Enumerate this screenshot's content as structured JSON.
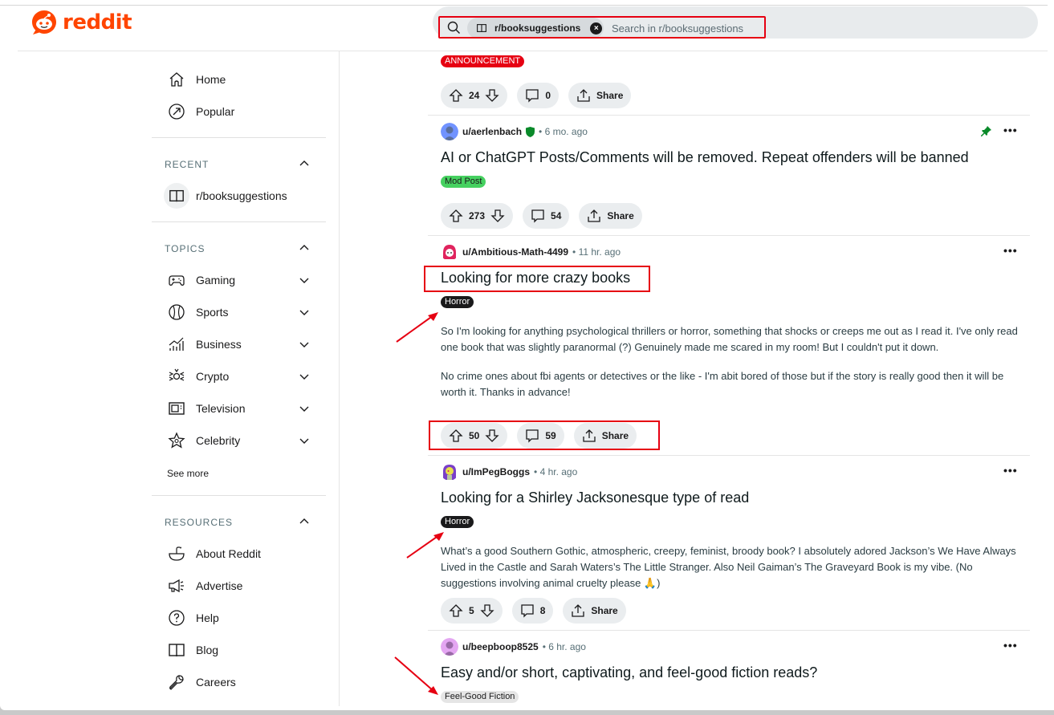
{
  "app": {
    "logo_text": "reddit",
    "brand_color": "#ff4500"
  },
  "search": {
    "community_chip": "r/booksuggestions",
    "placeholder": "Search in r/booksuggestions"
  },
  "sidebar": {
    "primary": [
      {
        "label": "Home",
        "icon": "home-icon"
      },
      {
        "label": "Popular",
        "icon": "popular-icon"
      }
    ],
    "recent": {
      "title": "RECENT",
      "items": [
        {
          "label": "r/booksuggestions",
          "icon": "book-icon"
        }
      ]
    },
    "topics": {
      "title": "TOPICS",
      "items": [
        {
          "label": "Gaming",
          "icon": "gamepad-icon"
        },
        {
          "label": "Sports",
          "icon": "ball-icon"
        },
        {
          "label": "Business",
          "icon": "chart-icon"
        },
        {
          "label": "Crypto",
          "icon": "crypto-icon"
        },
        {
          "label": "Television",
          "icon": "tv-icon"
        },
        {
          "label": "Celebrity",
          "icon": "star-icon"
        }
      ],
      "see_more": "See more"
    },
    "resources": {
      "title": "RESOURCES",
      "items": [
        {
          "label": "About Reddit",
          "icon": "reddit-icon"
        },
        {
          "label": "Advertise",
          "icon": "megaphone-icon"
        },
        {
          "label": "Help",
          "icon": "help-icon"
        },
        {
          "label": "Blog",
          "icon": "book-icon"
        },
        {
          "label": "Careers",
          "icon": "wrench-icon"
        }
      ]
    }
  },
  "posts": [
    {
      "flair": "ANNOUNCEMENT",
      "flair_bg": "#e60012",
      "flair_color": "#ffffff",
      "votes": "24",
      "comments": "0",
      "share": "Share"
    },
    {
      "author": "u/aerlenbach",
      "time": "6 mo. ago",
      "pinned": true,
      "moderator": true,
      "title": "AI or ChatGPT Posts/Comments will be removed. Repeat offenders will be banned",
      "flair": "Mod Post",
      "flair_bg": "#46d160",
      "flair_color": "#1a1a1b",
      "votes": "273",
      "comments": "54",
      "share": "Share"
    },
    {
      "author": "u/Ambitious-Math-4499",
      "time": "11 hr. ago",
      "title": "Looking for more crazy books",
      "flair": "Horror",
      "flair_bg": "#1a1a1b",
      "flair_color": "#ffffff",
      "body": [
        "So I'm looking for anything psychological thrillers or horror, something that shocks or creeps me out as I read it. I've only read one book that was slightly paranormal (?) Genuinely made me scared in my room! But I couldn't put it down.",
        "No crime ones about fbi agents or detectives or the like - I'm abit bored of those but if the story is really good then it will be worth it. Thanks in advance!"
      ],
      "votes": "50",
      "comments": "59",
      "share": "Share"
    },
    {
      "author": "u/ImPegBoggs",
      "time": "4 hr. ago",
      "title": "Looking for a Shirley Jacksonesque type of read",
      "flair": "Horror",
      "flair_bg": "#1a1a1b",
      "flair_color": "#ffffff",
      "body": [
        "What’s a good Southern Gothic, atmospheric, creepy, feminist, broody book? I absolutely adored Jackson’s We Have Always Lived in the Castle and Sarah Waters’s The Little Stranger. Also Neil Gaiman’s The Graveyard Book is my vibe. (No suggestions involving animal cruelty please 🙏)"
      ],
      "votes": "5",
      "comments": "8",
      "share": "Share"
    },
    {
      "author": "u/beepboop8525",
      "time": "6 hr. ago",
      "title": "Easy and/or short, captivating, and feel-good fiction reads?",
      "flair": "Feel-Good Fiction",
      "flair_bg": "#e5e5e5",
      "flair_color": "#1a1a1b"
    }
  ],
  "annotation_color": "#e60012"
}
